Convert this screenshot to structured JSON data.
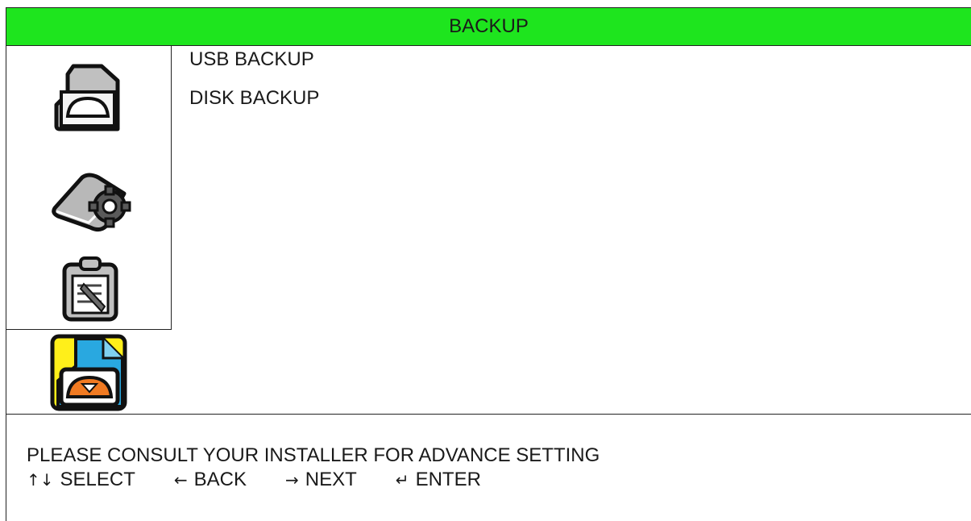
{
  "header": {
    "title": "BACKUP"
  },
  "sidebar": {
    "icons": [
      {
        "name": "usb-backup-icon",
        "selected": false
      },
      {
        "name": "disk-settings-icon",
        "selected": false
      },
      {
        "name": "clipboard-log-icon",
        "selected": false
      },
      {
        "name": "backup-folder-icon",
        "selected": true
      }
    ]
  },
  "menu": {
    "items": [
      {
        "label": "USB BACKUP"
      },
      {
        "label": "DISK BACKUP"
      }
    ]
  },
  "footer": {
    "notice": "PLEASE CONSULT YOUR INSTALLER FOR ADVANCE SETTING",
    "keys": [
      {
        "glyph": "↑↓",
        "label": "SELECT"
      },
      {
        "glyph": "←",
        "label": "BACK"
      },
      {
        "glyph": "→",
        "label": "NEXT"
      },
      {
        "glyph": "↵",
        "label": "ENTER"
      }
    ]
  },
  "colors": {
    "title_bar": "#1ee51e",
    "selected_icon_bg": "#ffef1a",
    "selected_icon_blue": "#29a8e0",
    "selected_icon_orange": "#f07a22"
  }
}
